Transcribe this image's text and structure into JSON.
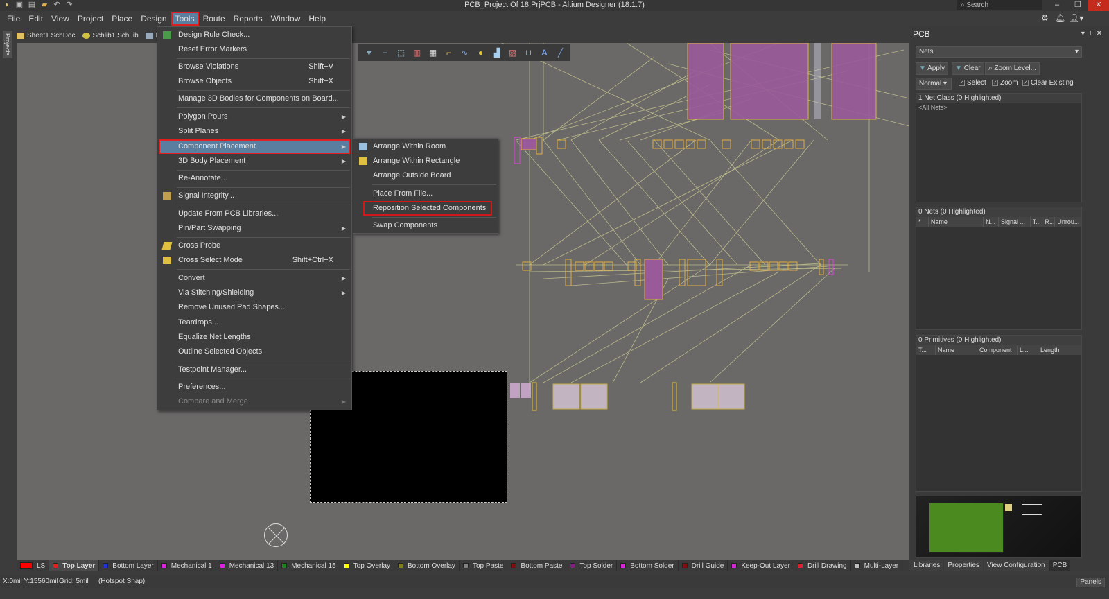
{
  "window": {
    "title": "PCB_Project Of 18.PrjPCB - Altium Designer (18.1.7)",
    "search_placeholder": "Search",
    "minimize": "–",
    "restore": "❐",
    "close": "✕"
  },
  "menubar": [
    "File",
    "Edit",
    "View",
    "Project",
    "Place",
    "Design",
    "Tools",
    "Route",
    "Reports",
    "Window",
    "Help"
  ],
  "active_menu": "Tools",
  "doc_tabs": [
    "Sheet1.SchDoc",
    "Schlib1.SchLib",
    "Pc"
  ],
  "projects_tab": "Projects",
  "tools_menu": [
    {
      "label": "Design Rule Check...",
      "icon": "drc-icon"
    },
    {
      "label": "Reset Error Markers"
    },
    {
      "label": "Browse Violations",
      "shortcut": "Shift+V"
    },
    {
      "label": "Browse Objects",
      "shortcut": "Shift+X"
    },
    {
      "label": "Manage 3D Bodies for Components on Board..."
    },
    {
      "label": "Polygon Pours",
      "submenu": true
    },
    {
      "label": "Split Planes",
      "submenu": true
    },
    {
      "label": "Component Placement",
      "submenu": true,
      "highlighted": true
    },
    {
      "label": "3D Body Placement",
      "submenu": true
    },
    {
      "label": "Re-Annotate..."
    },
    {
      "label": "Signal Integrity...",
      "icon": "signal-integrity-icon"
    },
    {
      "label": "Update From PCB Libraries..."
    },
    {
      "label": "Pin/Part Swapping",
      "submenu": true
    },
    {
      "label": "Cross Probe",
      "icon": "cross-probe-icon"
    },
    {
      "label": "Cross Select Mode",
      "shortcut": "Shift+Ctrl+X",
      "icon": "cross-select-icon"
    },
    {
      "label": "Convert",
      "submenu": true
    },
    {
      "label": "Via Stitching/Shielding",
      "submenu": true
    },
    {
      "label": "Remove Unused Pad Shapes..."
    },
    {
      "label": "Teardrops..."
    },
    {
      "label": "Equalize Net Lengths"
    },
    {
      "label": "Outline Selected Objects"
    },
    {
      "label": "Testpoint Manager..."
    },
    {
      "label": "Preferences..."
    },
    {
      "label": "Compare and Merge",
      "submenu": true,
      "disabled": true
    }
  ],
  "component_placement_submenu": [
    {
      "label": "Arrange Within Room",
      "icon": "arrange-room-icon"
    },
    {
      "label": "Arrange Within Rectangle",
      "icon": "arrange-rect-icon"
    },
    {
      "label": "Arrange Outside Board"
    },
    {
      "label": "Place From File..."
    },
    {
      "label": "Reposition Selected Components",
      "boxed": true
    },
    {
      "label": "Swap Components"
    }
  ],
  "pcb_panel": {
    "title": "PCB",
    "mode_select": "Nets",
    "apply": "Apply",
    "clear": "Clear",
    "zoom_level": "Zoom Level...",
    "view_mode": "Normal",
    "checkboxes": [
      {
        "label": "Select",
        "checked": true
      },
      {
        "label": "Zoom",
        "checked": true
      },
      {
        "label": "Clear Existing",
        "checked": true
      }
    ],
    "net_class_header": "1 Net Class (0 Highlighted)",
    "net_class_items": [
      "<All Nets>"
    ],
    "nets_header": "0 Nets (0 Highlighted)",
    "nets_columns": [
      "*",
      "Name",
      "N...",
      "Signal ...",
      "T...",
      "R...",
      "Unrou..."
    ],
    "primitives_header": "0 Primitives (0 Highlighted)",
    "primitives_columns": [
      "T...",
      "Name",
      "Component",
      "L...",
      "Length"
    ],
    "bottom_tabs": [
      "Libraries",
      "Properties",
      "View Configuration",
      "PCB"
    ],
    "active_bottom_tab": "PCB"
  },
  "layers": [
    {
      "label": "LS",
      "color": "#ff0000"
    },
    {
      "label": "Top Layer",
      "color": "#e02020",
      "active": true
    },
    {
      "label": "Bottom Layer",
      "color": "#2030e0"
    },
    {
      "label": "Mechanical 1",
      "color": "#e020e0"
    },
    {
      "label": "Mechanical 13",
      "color": "#e020e0"
    },
    {
      "label": "Mechanical 15",
      "color": "#208020"
    },
    {
      "label": "Top Overlay",
      "color": "#ffff00"
    },
    {
      "label": "Bottom Overlay",
      "color": "#808020"
    },
    {
      "label": "Top Paste",
      "color": "#808080"
    },
    {
      "label": "Bottom Paste",
      "color": "#801010"
    },
    {
      "label": "Top Solder",
      "color": "#802080"
    },
    {
      "label": "Bottom Solder",
      "color": "#e020e0"
    },
    {
      "label": "Drill Guide",
      "color": "#801010"
    },
    {
      "label": "Keep-Out Layer",
      "color": "#e020e0"
    },
    {
      "label": "Drill Drawing",
      "color": "#e02030"
    },
    {
      "label": "Multi-Layer",
      "color": "#c0c0c0"
    }
  ],
  "status": {
    "coords": "X:0mil Y:15560mil",
    "grid": "Grid: 5mil",
    "snap": "(Hotspot Snap)",
    "panels": "Panels"
  },
  "pcb_toolbar": [
    "filter-icon",
    "crosshair-icon",
    "select-rect-icon",
    "align-icon",
    "component-icon",
    "route-icon",
    "interactive-diff-pair-icon",
    "place-pad-icon",
    "polygon-icon",
    "fill-icon",
    "dimension-icon",
    "string-icon",
    "line-icon"
  ],
  "colors": {
    "accent": "#5a7ea0",
    "annotation_red": "#e02020",
    "board_green": "#4a8a1e"
  }
}
